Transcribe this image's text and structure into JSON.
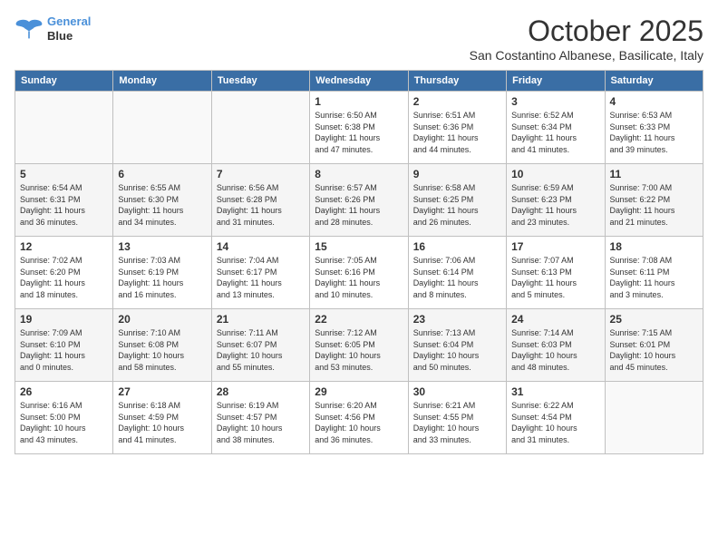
{
  "logo": {
    "line1": "General",
    "line2": "Blue"
  },
  "title": "October 2025",
  "subtitle": "San Costantino Albanese, Basilicate, Italy",
  "headers": [
    "Sunday",
    "Monday",
    "Tuesday",
    "Wednesday",
    "Thursday",
    "Friday",
    "Saturday"
  ],
  "weeks": [
    [
      {
        "day": "",
        "info": ""
      },
      {
        "day": "",
        "info": ""
      },
      {
        "day": "",
        "info": ""
      },
      {
        "day": "1",
        "info": "Sunrise: 6:50 AM\nSunset: 6:38 PM\nDaylight: 11 hours\nand 47 minutes."
      },
      {
        "day": "2",
        "info": "Sunrise: 6:51 AM\nSunset: 6:36 PM\nDaylight: 11 hours\nand 44 minutes."
      },
      {
        "day": "3",
        "info": "Sunrise: 6:52 AM\nSunset: 6:34 PM\nDaylight: 11 hours\nand 41 minutes."
      },
      {
        "day": "4",
        "info": "Sunrise: 6:53 AM\nSunset: 6:33 PM\nDaylight: 11 hours\nand 39 minutes."
      }
    ],
    [
      {
        "day": "5",
        "info": "Sunrise: 6:54 AM\nSunset: 6:31 PM\nDaylight: 11 hours\nand 36 minutes."
      },
      {
        "day": "6",
        "info": "Sunrise: 6:55 AM\nSunset: 6:30 PM\nDaylight: 11 hours\nand 34 minutes."
      },
      {
        "day": "7",
        "info": "Sunrise: 6:56 AM\nSunset: 6:28 PM\nDaylight: 11 hours\nand 31 minutes."
      },
      {
        "day": "8",
        "info": "Sunrise: 6:57 AM\nSunset: 6:26 PM\nDaylight: 11 hours\nand 28 minutes."
      },
      {
        "day": "9",
        "info": "Sunrise: 6:58 AM\nSunset: 6:25 PM\nDaylight: 11 hours\nand 26 minutes."
      },
      {
        "day": "10",
        "info": "Sunrise: 6:59 AM\nSunset: 6:23 PM\nDaylight: 11 hours\nand 23 minutes."
      },
      {
        "day": "11",
        "info": "Sunrise: 7:00 AM\nSunset: 6:22 PM\nDaylight: 11 hours\nand 21 minutes."
      }
    ],
    [
      {
        "day": "12",
        "info": "Sunrise: 7:02 AM\nSunset: 6:20 PM\nDaylight: 11 hours\nand 18 minutes."
      },
      {
        "day": "13",
        "info": "Sunrise: 7:03 AM\nSunset: 6:19 PM\nDaylight: 11 hours\nand 16 minutes."
      },
      {
        "day": "14",
        "info": "Sunrise: 7:04 AM\nSunset: 6:17 PM\nDaylight: 11 hours\nand 13 minutes."
      },
      {
        "day": "15",
        "info": "Sunrise: 7:05 AM\nSunset: 6:16 PM\nDaylight: 11 hours\nand 10 minutes."
      },
      {
        "day": "16",
        "info": "Sunrise: 7:06 AM\nSunset: 6:14 PM\nDaylight: 11 hours\nand 8 minutes."
      },
      {
        "day": "17",
        "info": "Sunrise: 7:07 AM\nSunset: 6:13 PM\nDaylight: 11 hours\nand 5 minutes."
      },
      {
        "day": "18",
        "info": "Sunrise: 7:08 AM\nSunset: 6:11 PM\nDaylight: 11 hours\nand 3 minutes."
      }
    ],
    [
      {
        "day": "19",
        "info": "Sunrise: 7:09 AM\nSunset: 6:10 PM\nDaylight: 11 hours\nand 0 minutes."
      },
      {
        "day": "20",
        "info": "Sunrise: 7:10 AM\nSunset: 6:08 PM\nDaylight: 10 hours\nand 58 minutes."
      },
      {
        "day": "21",
        "info": "Sunrise: 7:11 AM\nSunset: 6:07 PM\nDaylight: 10 hours\nand 55 minutes."
      },
      {
        "day": "22",
        "info": "Sunrise: 7:12 AM\nSunset: 6:05 PM\nDaylight: 10 hours\nand 53 minutes."
      },
      {
        "day": "23",
        "info": "Sunrise: 7:13 AM\nSunset: 6:04 PM\nDaylight: 10 hours\nand 50 minutes."
      },
      {
        "day": "24",
        "info": "Sunrise: 7:14 AM\nSunset: 6:03 PM\nDaylight: 10 hours\nand 48 minutes."
      },
      {
        "day": "25",
        "info": "Sunrise: 7:15 AM\nSunset: 6:01 PM\nDaylight: 10 hours\nand 45 minutes."
      }
    ],
    [
      {
        "day": "26",
        "info": "Sunrise: 6:16 AM\nSunset: 5:00 PM\nDaylight: 10 hours\nand 43 minutes."
      },
      {
        "day": "27",
        "info": "Sunrise: 6:18 AM\nSunset: 4:59 PM\nDaylight: 10 hours\nand 41 minutes."
      },
      {
        "day": "28",
        "info": "Sunrise: 6:19 AM\nSunset: 4:57 PM\nDaylight: 10 hours\nand 38 minutes."
      },
      {
        "day": "29",
        "info": "Sunrise: 6:20 AM\nSunset: 4:56 PM\nDaylight: 10 hours\nand 36 minutes."
      },
      {
        "day": "30",
        "info": "Sunrise: 6:21 AM\nSunset: 4:55 PM\nDaylight: 10 hours\nand 33 minutes."
      },
      {
        "day": "31",
        "info": "Sunrise: 6:22 AM\nSunset: 4:54 PM\nDaylight: 10 hours\nand 31 minutes."
      },
      {
        "day": "",
        "info": ""
      }
    ]
  ]
}
